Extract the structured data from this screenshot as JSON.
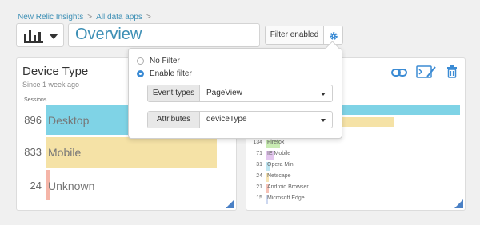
{
  "breadcrumb": {
    "items": [
      "New Relic Insights",
      "All data apps"
    ],
    "separator": ">"
  },
  "header": {
    "title": "Overview",
    "filter_button": "Filter enabled"
  },
  "filter_popover": {
    "options": [
      {
        "label": "No Filter",
        "selected": false
      },
      {
        "label": "Enable filter",
        "selected": true
      }
    ],
    "fields": [
      {
        "label": "Event types",
        "value": "PageView"
      },
      {
        "label": "Attributes",
        "value": "deviceType"
      }
    ]
  },
  "left_card": {
    "title": "Device Type",
    "subtitle": "Since 1 week ago",
    "axis_label": "Sessions",
    "rows": [
      {
        "value": "896",
        "label": "Desktop",
        "color": "#7fd3e6"
      },
      {
        "value": "833",
        "label": "Mobile",
        "color": "#f5e2a6"
      },
      {
        "value": "24",
        "label": "Unknown",
        "color": "#f5b5a8"
      }
    ]
  },
  "right_card": {
    "rows": [
      {
        "value": "134",
        "label": "Firefox",
        "color": "#c9ecb3"
      },
      {
        "value": "71",
        "label": "IE Mobile",
        "color": "#e3c6ee"
      },
      {
        "value": "31",
        "label": "Opera Mini",
        "color": "#bfe6f1"
      },
      {
        "value": "24",
        "label": "Netscape",
        "color": "#f7e4b3"
      },
      {
        "value": "21",
        "label": "Android Browser",
        "color": "#f5c0b5"
      },
      {
        "value": "15",
        "label": "Microsoft Edge",
        "color": "#cdd8f0"
      }
    ]
  },
  "colors": {
    "accent": "#3d8fb5",
    "radio_selected": "#3b8bd4",
    "resize_handle": "#4a80c5"
  },
  "icons": [
    "bar-chart-icon",
    "chevron-down-icon",
    "gear-icon",
    "link-icon",
    "terminal-edit-icon",
    "trash-icon"
  ]
}
